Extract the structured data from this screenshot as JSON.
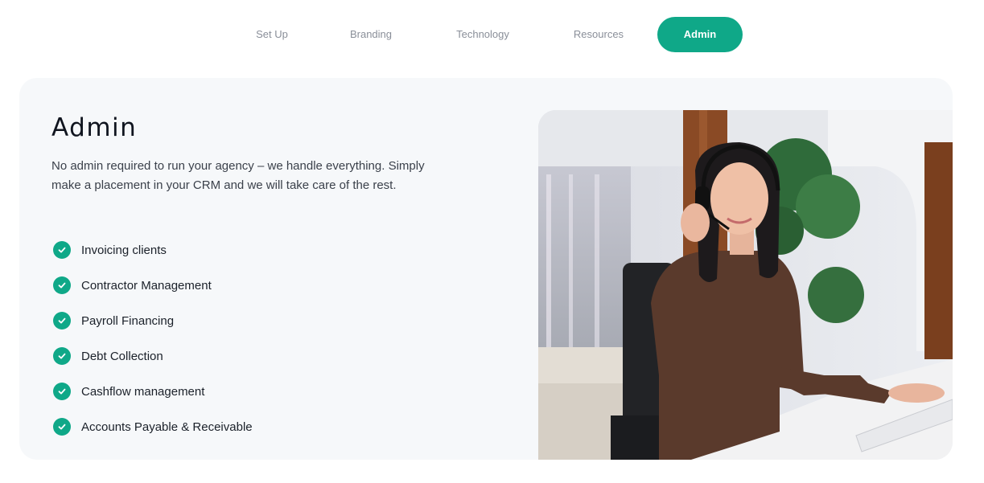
{
  "nav": {
    "tabs": [
      {
        "label": "Set Up",
        "active": false
      },
      {
        "label": "Branding",
        "active": false
      },
      {
        "label": "Technology",
        "active": false
      },
      {
        "label": "Resources",
        "active": false
      },
      {
        "label": "Admin",
        "active": true
      }
    ],
    "accent_color": "#0fa888"
  },
  "section": {
    "title": "Admin",
    "description": "No admin required to run your agency – we handle everything. Simply make a placement in your CRM and we will take care of the rest.",
    "features": [
      "Invoicing clients",
      "Contractor Management",
      "Payroll Financing",
      "Debt Collection",
      "Cashflow management",
      "Accounts Payable & Receivable"
    ],
    "feature_icon": "check-circle-icon"
  }
}
